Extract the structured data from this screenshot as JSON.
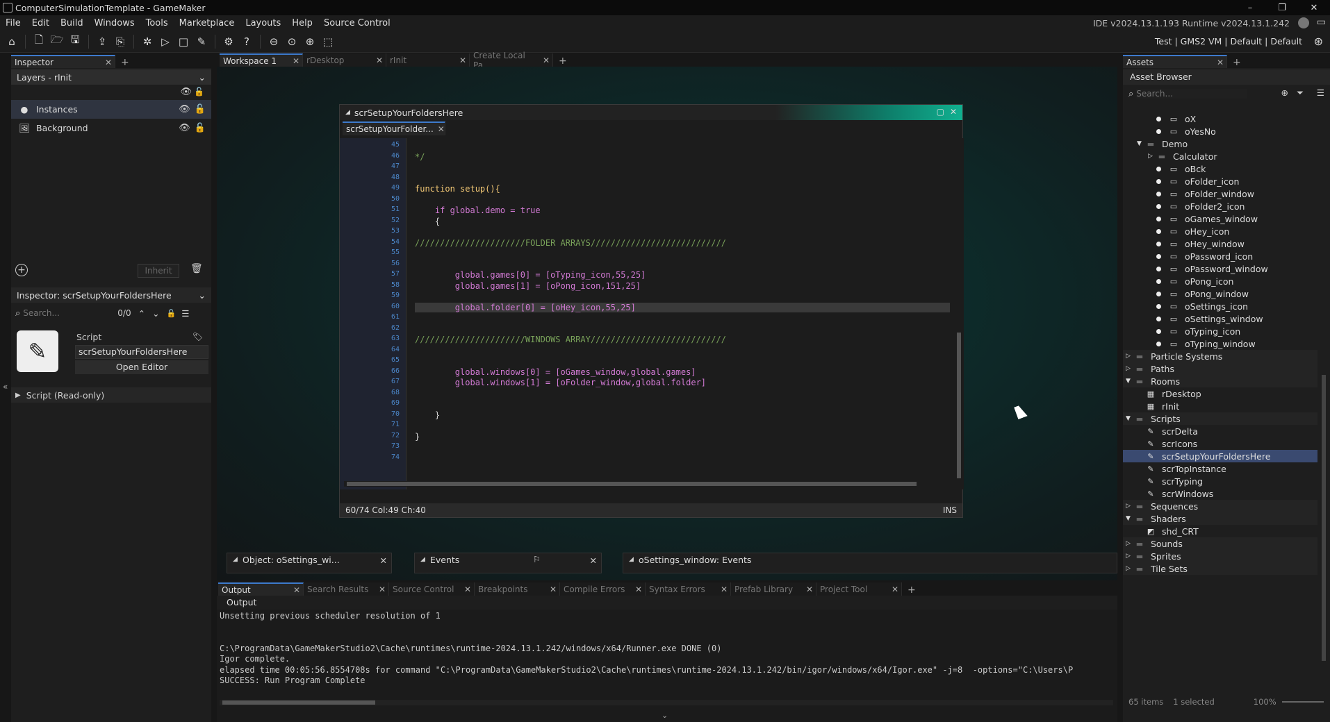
{
  "window": {
    "title": "ComputerSimulationTemplate - GameMaker",
    "min": "–",
    "max": "❐",
    "close": "✕"
  },
  "menu": {
    "items": [
      "File",
      "Edit",
      "Build",
      "Windows",
      "Tools",
      "Marketplace",
      "Layouts",
      "Help",
      "Source Control"
    ],
    "version": "IDE v2024.13.1.193  Runtime v2024.13.1.242"
  },
  "toolbar": {
    "target": "Test | GMS2 VM | Default | Default"
  },
  "inspector": {
    "tab": "Inspector",
    "layers_dropdown": "Layers - rInit",
    "layers": [
      {
        "name": "Instances"
      },
      {
        "name": "Background"
      }
    ],
    "inherit": "Inherit",
    "script_dropdown": "Inspector: scrSetupYourFoldersHere",
    "search_placeholder": "Search...",
    "search_count": "0/0",
    "script_label": "Script",
    "script_name": "scrSetupYourFoldersHere",
    "open_editor": "Open Editor",
    "readonly": "Script (Read-only)"
  },
  "workspace_tabs": [
    {
      "label": "Workspace 1"
    },
    {
      "label": "rDesktop"
    },
    {
      "label": "rInit"
    },
    {
      "label": "Create Local Pa..."
    }
  ],
  "code_window": {
    "title": "scrSetupYourFoldersHere",
    "tab": "scrSetupYourFolder...",
    "status_left": "60/74 Col:49 Ch:40",
    "status_right": "INS",
    "lines": [
      {
        "n": "45",
        "t": ""
      },
      {
        "n": "46",
        "t": "*/"
      },
      {
        "n": "47",
        "t": ""
      },
      {
        "n": "48",
        "t": ""
      },
      {
        "n": "49",
        "t": "function setup(){"
      },
      {
        "n": "50",
        "t": ""
      },
      {
        "n": "51",
        "t": "    if global.demo = true"
      },
      {
        "n": "52",
        "t": "    {"
      },
      {
        "n": "53",
        "t": ""
      },
      {
        "n": "54",
        "t": "//////////////////////FOLDER ARRAYS///////////////////////////"
      },
      {
        "n": "55",
        "t": ""
      },
      {
        "n": "56",
        "t": ""
      },
      {
        "n": "57",
        "t": "        global.games[0] = [oTyping_icon,55,25]"
      },
      {
        "n": "58",
        "t": "        global.games[1] = [oPong_icon,151,25]"
      },
      {
        "n": "59",
        "t": ""
      },
      {
        "n": "60",
        "t": "        global.folder[0] = [oHey_icon,55,25]"
      },
      {
        "n": "61",
        "t": ""
      },
      {
        "n": "62",
        "t": ""
      },
      {
        "n": "63",
        "t": "//////////////////////WINDOWS ARRAY///////////////////////////"
      },
      {
        "n": "64",
        "t": ""
      },
      {
        "n": "65",
        "t": ""
      },
      {
        "n": "66",
        "t": "        global.windows[0] = [oGames_window,global.games]"
      },
      {
        "n": "67",
        "t": "        global.windows[1] = [oFolder_window,global.folder]"
      },
      {
        "n": "68",
        "t": ""
      },
      {
        "n": "69",
        "t": ""
      },
      {
        "n": "70",
        "t": "    }"
      },
      {
        "n": "71",
        "t": ""
      },
      {
        "n": "72",
        "t": "}"
      },
      {
        "n": "73",
        "t": ""
      },
      {
        "n": "74",
        "t": ""
      }
    ]
  },
  "docked": {
    "object_panel": "Object: oSettings_wi...",
    "events_panel": "Events",
    "events2_panel": "oSettings_window: Events"
  },
  "output_tabs": [
    "Output",
    "Search Results",
    "Source Control",
    "Breakpoints",
    "Compile Errors",
    "Syntax Errors",
    "Prefab Library",
    "Project Tool"
  ],
  "output": {
    "header": "Output",
    "lines": [
      "Unsetting previous scheduler resolution of 1",
      "",
      "",
      "C:\\ProgramData\\GameMakerStudio2\\Cache\\runtimes\\runtime-2024.13.1.242/windows/x64/Runner.exe DONE (0)",
      "Igor complete.",
      "elapsed time 00:05:56.8554708s for command \"C:\\ProgramData\\GameMakerStudio2\\Cache\\runtimes\\runtime-2024.13.1.242/bin/igor/windows/x64/Igor.exe\" -j=8  -options=\"C:\\Users\\P",
      "SUCCESS: Run Program Complete"
    ]
  },
  "assets": {
    "tab": "Assets",
    "header": "Asset Browser",
    "search_placeholder": "Search...",
    "items": [
      {
        "label": "oX",
        "kind": "obj"
      },
      {
        "label": "oYesNo",
        "kind": "obj"
      },
      {
        "label": "Demo",
        "kind": "folder-open"
      },
      {
        "label": "Calculator",
        "kind": "folder"
      },
      {
        "label": "oBck",
        "kind": "obj"
      },
      {
        "label": "oFolder_icon",
        "kind": "obj"
      },
      {
        "label": "oFolder_window",
        "kind": "obj"
      },
      {
        "label": "oFolder2_icon",
        "kind": "obj"
      },
      {
        "label": "oGames_window",
        "kind": "obj"
      },
      {
        "label": "oHey_icon",
        "kind": "obj"
      },
      {
        "label": "oHey_window",
        "kind": "obj"
      },
      {
        "label": "oPassword_icon",
        "kind": "obj"
      },
      {
        "label": "oPassword_window",
        "kind": "obj"
      },
      {
        "label": "oPong_icon",
        "kind": "obj"
      },
      {
        "label": "oPong_window",
        "kind": "obj"
      },
      {
        "label": "oSettings_icon",
        "kind": "obj"
      },
      {
        "label": "oSettings_window",
        "kind": "obj"
      },
      {
        "label": "oTyping_icon",
        "kind": "obj"
      },
      {
        "label": "oTyping_window",
        "kind": "obj"
      },
      {
        "label": "Particle Systems",
        "kind": "group"
      },
      {
        "label": "Paths",
        "kind": "group"
      },
      {
        "label": "Rooms",
        "kind": "group-open"
      },
      {
        "label": "rDesktop",
        "kind": "room"
      },
      {
        "label": "rInit",
        "kind": "room"
      },
      {
        "label": "Scripts",
        "kind": "group-open"
      },
      {
        "label": "scrDelta",
        "kind": "script"
      },
      {
        "label": "scrIcons",
        "kind": "script"
      },
      {
        "label": "scrSetupYourFoldersHere",
        "kind": "script-sel"
      },
      {
        "label": "scrTopInstance",
        "kind": "script"
      },
      {
        "label": "scrTyping",
        "kind": "script"
      },
      {
        "label": "scrWindows",
        "kind": "script"
      },
      {
        "label": "Sequences",
        "kind": "group"
      },
      {
        "label": "Shaders",
        "kind": "group-open"
      },
      {
        "label": "shd_CRT",
        "kind": "shader"
      },
      {
        "label": "Sounds",
        "kind": "group"
      },
      {
        "label": "Sprites",
        "kind": "group"
      },
      {
        "label": "Tile Sets",
        "kind": "group"
      }
    ],
    "footer_count": "65 items",
    "footer_selected": "1 selected",
    "footer_zoom": "100%"
  }
}
